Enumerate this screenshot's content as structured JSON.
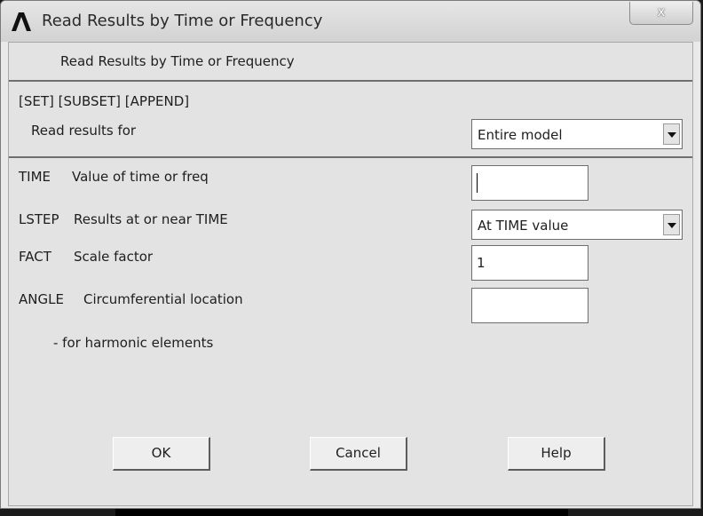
{
  "window": {
    "title": "Read Results by Time or Frequency",
    "close_label": "x"
  },
  "header": {
    "text": "Read Results by Time or Frequency"
  },
  "set_section": {
    "command_label": "[SET] [SUBSET] [APPEND]",
    "read_results_label": "Read results for",
    "read_results_value": "Entire model"
  },
  "fields": {
    "time": {
      "keyword": "TIME",
      "description": "Value of time or freq",
      "value": ""
    },
    "lstep": {
      "keyword": "LSTEP",
      "description": "Results at or near TIME",
      "value": "At TIME value"
    },
    "fact": {
      "keyword": "FACT",
      "description": "Scale factor",
      "value": "1"
    },
    "angle": {
      "keyword": "ANGLE",
      "description": "Circumferential location",
      "note": "- for harmonic elements",
      "value": ""
    }
  },
  "buttons": {
    "ok": "OK",
    "cancel": "Cancel",
    "help": "Help"
  }
}
